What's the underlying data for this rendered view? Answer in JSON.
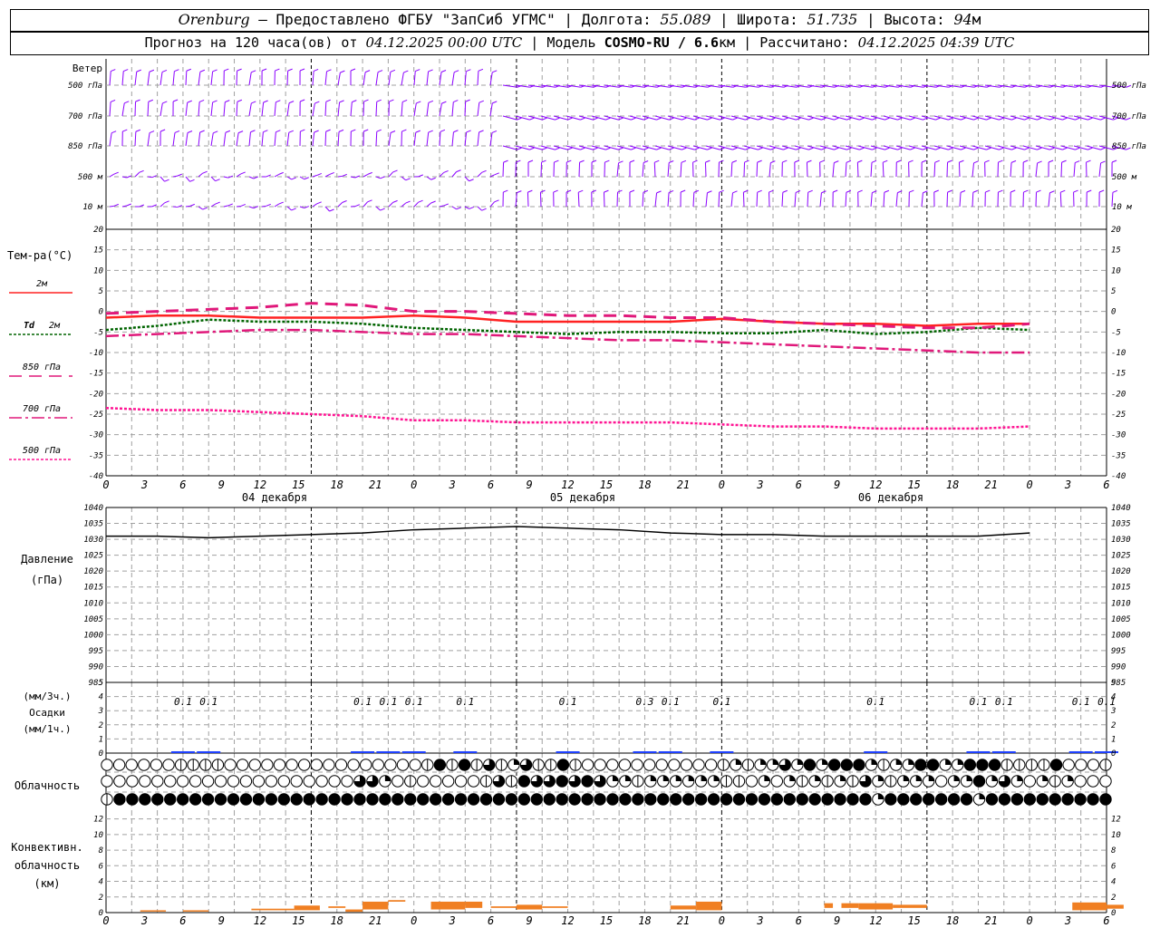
{
  "header": {
    "station": "Orenburg",
    "provided": "— Предоставлено ФГБУ \"ЗапСиб УГМС\"",
    "lon_label": "Долгота:",
    "lon": "55.089",
    "lat_label": "Широта:",
    "lat": "51.735",
    "alt_label": "Высота:",
    "alt": "94",
    "alt_unit": "м",
    "forecast_text": "Прогноз на 120 часа(ов) от",
    "start_time": "04.12.2025 00:00 UTC",
    "model_label": "Модель",
    "model": "COSMO-RU / 6.6",
    "model_unit": "км",
    "computed_label": "Рассчитано:",
    "computed_time": "04.12.2025 04:39 UTC"
  },
  "colors": {
    "wind": "#8b00ff",
    "t2m": "#ff2222",
    "td2m": "#006400",
    "t850": "#e0187a",
    "t700": "#e0187a",
    "t500": "#ff1493",
    "pressure": "#000000",
    "precip": "#1e40ff",
    "convective": "#f07f22",
    "grid": "#a0a0a0"
  },
  "time_axis": {
    "hour_labels": [
      "0",
      "3",
      "6",
      "9",
      "12",
      "15",
      "18",
      "21",
      "0",
      "3",
      "6",
      "9",
      "12",
      "15",
      "18",
      "21",
      "0",
      "3",
      "6",
      "9",
      "12",
      "15",
      "18",
      "21",
      "0",
      "3",
      "6"
    ],
    "day_labels": [
      "04 декабря",
      "05 декабря",
      "06 декабря"
    ]
  },
  "labels": {
    "wind": "Ветер",
    "wind_levels": [
      "500 гПа",
      "700 гПа",
      "850 гПа",
      "500 м",
      "10 м"
    ],
    "temp": "Тем-ра(°C)",
    "t2m": "2м",
    "td_prefix": "Td",
    "td_level": "2м",
    "t850": "850 гПа",
    "t700": "700 гПа",
    "t500": "500 гПа",
    "pressure": "Давление",
    "pressure_unit": "(гПа)",
    "precip_top": "(мм/3ч.)",
    "precip": "Осадки",
    "precip_bottom": "(мм/1ч.)",
    "clouds": "Облачность",
    "conv1": "Конвективн.",
    "conv2": "облачность",
    "conv3": "(км)"
  },
  "chart_data": [
    {
      "type": "line",
      "name": "temperature",
      "x_hours": [
        0,
        6,
        12,
        18,
        24,
        30,
        36,
        42,
        48,
        54,
        60,
        66,
        72,
        78,
        84,
        90,
        96,
        102,
        108
      ],
      "series": [
        {
          "name": "2м",
          "values": [
            -1.5,
            -1,
            -1,
            -1.5,
            -1.5,
            -1.5,
            -1,
            -1.5,
            -2.5,
            -2.5,
            -2.5,
            -2.5,
            -1.8,
            -2.5,
            -3,
            -3,
            -3.5,
            -3,
            -3
          ]
        },
        {
          "name": "Td 2м",
          "values": [
            -4.5,
            -3.5,
            -2,
            -2.5,
            -2.5,
            -3,
            -4,
            -4.5,
            -5,
            -5.5,
            -5,
            -5,
            -5.3,
            -5.3,
            -4.5,
            -5.5,
            -5,
            -4,
            -4.5
          ]
        },
        {
          "name": "850 гПа",
          "values": [
            -0.5,
            0,
            0.5,
            1,
            2,
            1.5,
            0,
            0,
            -0.5,
            -1,
            -1,
            -1.5,
            -1.5,
            -2.5,
            -3,
            -3.5,
            -4,
            -4,
            -3
          ]
        },
        {
          "name": "700 гПа",
          "values": [
            -6,
            -5.5,
            -5,
            -4.5,
            -4.5,
            -5,
            -5.5,
            -5.5,
            -6,
            -6.5,
            -7,
            -7,
            -7.5,
            -8,
            -8.5,
            -9,
            -9.5,
            -10,
            -10
          ]
        },
        {
          "name": "500 гПа",
          "values": [
            -23.5,
            -24,
            -24,
            -24.5,
            -25,
            -25.5,
            -26.5,
            -26.5,
            -27,
            -27,
            -27,
            -27,
            -27.5,
            -28,
            -28,
            -28.5,
            -28.5,
            -28.5,
            -28
          ]
        }
      ],
      "ylim": [
        -40,
        20
      ],
      "y_ticks": [
        -40,
        -35,
        -30,
        -25,
        -20,
        -15,
        -10,
        -5,
        0,
        5,
        10,
        15,
        20
      ]
    },
    {
      "type": "line",
      "name": "pressure",
      "x_hours": [
        0,
        6,
        12,
        18,
        24,
        30,
        36,
        42,
        48,
        54,
        60,
        66,
        72,
        78,
        84,
        90,
        96,
        102,
        108
      ],
      "values": [
        1031,
        1031,
        1030.5,
        1031,
        1031.5,
        1032,
        1033,
        1033.5,
        1034,
        1033.5,
        1033,
        1032,
        1031.5,
        1031.5,
        1031,
        1031,
        1031,
        1031,
        1032
      ],
      "ylim": [
        985,
        1040
      ],
      "y_ticks": [
        985,
        990,
        995,
        1000,
        1005,
        1010,
        1015,
        1020,
        1025,
        1030,
        1035,
        1040
      ]
    },
    {
      "type": "bar",
      "name": "precipitation",
      "x_hours": [
        9,
        12,
        30,
        33,
        36,
        42,
        54,
        63,
        66,
        72,
        90,
        102,
        105,
        114,
        117
      ],
      "values": [
        0.1,
        0.1,
        0.1,
        0.1,
        0.1,
        0.1,
        0.1,
        0.3,
        0.1,
        0.1,
        0.1,
        0.1,
        0.1,
        0.1,
        0.1
      ],
      "value_labels": [
        "0.1",
        "0.1",
        "0.1",
        "0.1",
        "0.1",
        "0.1",
        "0.1",
        "0.3",
        "0.1",
        "0.1",
        "0.1",
        "0.1",
        "0.1",
        "0.1",
        "0.1"
      ],
      "ylim": [
        0,
        5
      ],
      "y_ticks": [
        0,
        1,
        2,
        3,
        4,
        5
      ]
    },
    {
      "type": "bar",
      "name": "convective_cloud",
      "bars": [
        {
          "x0": 4,
          "x1": 7,
          "bottom": 0.2,
          "top": 0.3
        },
        {
          "x0": 9,
          "x1": 12,
          "bottom": 0.2,
          "top": 0.3
        },
        {
          "x0": 17,
          "x1": 22,
          "bottom": 0.3,
          "top": 0.5
        },
        {
          "x0": 22,
          "x1": 25,
          "bottom": 0.3,
          "top": 0.9
        },
        {
          "x0": 26,
          "x1": 28,
          "bottom": 0.6,
          "top": 0.8
        },
        {
          "x0": 28,
          "x1": 30,
          "bottom": 0.1,
          "top": 0.4
        },
        {
          "x0": 30,
          "x1": 33,
          "bottom": 0.4,
          "top": 1.4
        },
        {
          "x0": 33,
          "x1": 35,
          "bottom": 1.4,
          "top": 1.6
        },
        {
          "x0": 38,
          "x1": 42,
          "bottom": 0.4,
          "top": 1.4
        },
        {
          "x0": 42,
          "x1": 44,
          "bottom": 0.6,
          "top": 1.4
        },
        {
          "x0": 45,
          "x1": 48,
          "bottom": 0.6,
          "top": 0.8
        },
        {
          "x0": 48,
          "x1": 51,
          "bottom": 0.4,
          "top": 1.0
        },
        {
          "x0": 51,
          "x1": 54,
          "bottom": 0.6,
          "top": 0.8
        },
        {
          "x0": 66,
          "x1": 69,
          "bottom": 0.4,
          "top": 0.9
        },
        {
          "x0": 69,
          "x1": 72,
          "bottom": 0.3,
          "top": 1.4
        },
        {
          "x0": 84,
          "x1": 85,
          "bottom": 0.6,
          "top": 1.2
        },
        {
          "x0": 86,
          "x1": 88,
          "bottom": 0.6,
          "top": 1.2
        },
        {
          "x0": 88,
          "x1": 92,
          "bottom": 0.4,
          "top": 1.2
        },
        {
          "x0": 92,
          "x1": 96,
          "bottom": 0.6,
          "top": 1.0
        },
        {
          "x0": 113,
          "x1": 117,
          "bottom": 0.3,
          "top": 1.3
        },
        {
          "x0": 117,
          "x1": 119,
          "bottom": 0.5,
          "top": 1.0
        }
      ],
      "ylim": [
        0,
        13
      ],
      "y_ticks": [
        0,
        2,
        4,
        6,
        8,
        10,
        12
      ]
    }
  ],
  "clouds": {
    "row1": "OOOOOOHHHHOOOOOOOOOOOOOOOOHMHMHTHQTHHMHOOOOOOOOOOOHQHQQTQMQMMMQHQQMMQQMMMHHHHMOOOH",
    "row2": "OOOOOOOOOOOOOOOOOOOOTTQOHOOOOOHTHMTTMTMTQQHQQQQQQHHOQOQHQHQHTQHQQQOQQMQTQOQHQOOO",
    "row3": "HMMMMMMMMMMMMMMMMMMMMMMMMMMMMMMMMMMMMMMMMMMMMMMMMMMMMMMMMMMMMQMMMMMMMQMMMMMMMMMM"
  }
}
